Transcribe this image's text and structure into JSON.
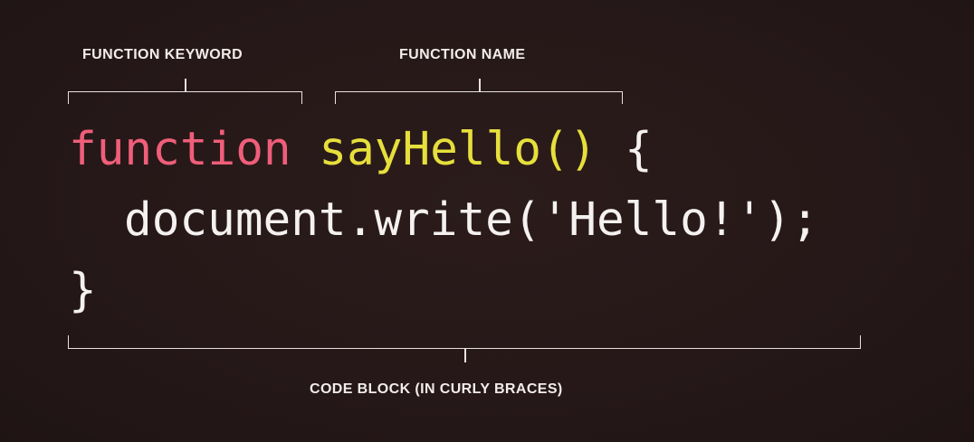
{
  "labels": {
    "keyword": "FUNCTION KEYWORD",
    "name": "FUNCTION NAME",
    "block": "CODE BLOCK (IN CURLY BRACES)"
  },
  "code": {
    "keyword": "function",
    "name": "sayHello()",
    "open_brace": "{",
    "body": "document.write('Hello!');",
    "close_brace": "}"
  },
  "colors": {
    "background": "#261818",
    "keyword": "#ef5e7a",
    "function_name": "#e6df3c",
    "code_text": "#f4f1f0",
    "labels": "#f2ecea"
  }
}
